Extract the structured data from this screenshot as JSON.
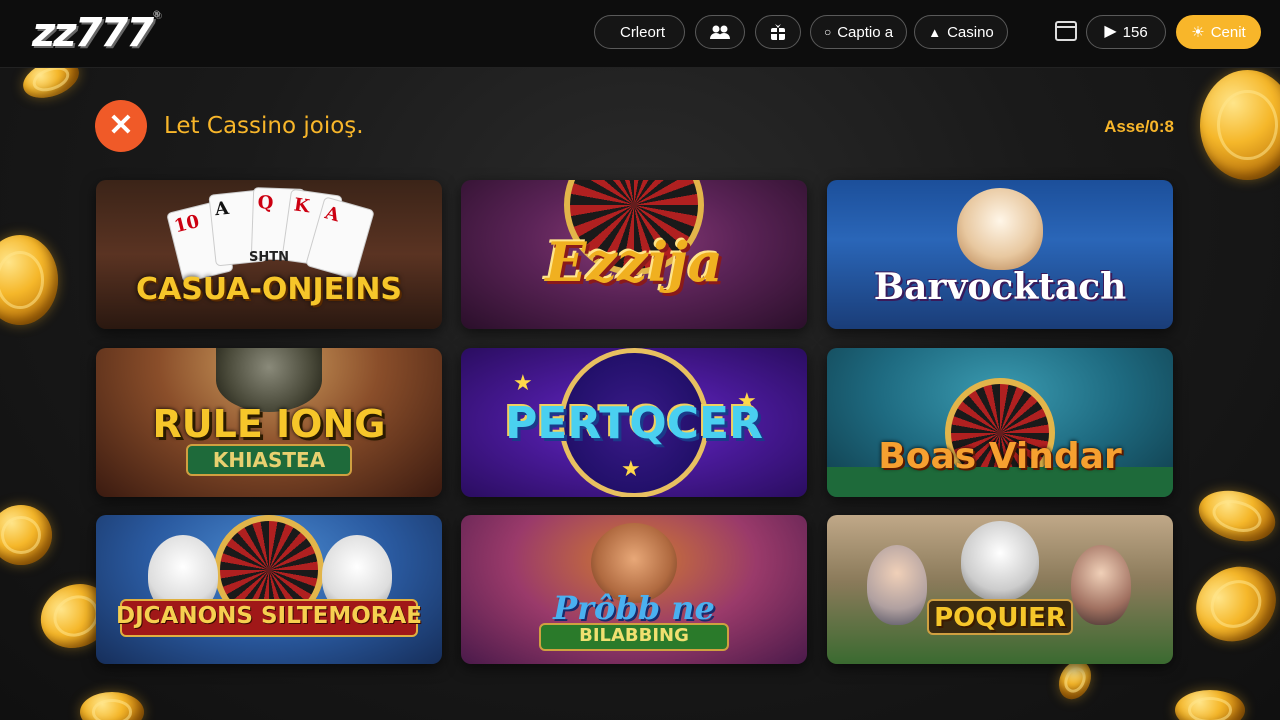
{
  "brand": {
    "logo_text": "zz777",
    "logo_mark": "®"
  },
  "nav": {
    "items": [
      {
        "label": "Crleort",
        "icon": "apple-icon"
      },
      {
        "label": "",
        "icon": "users-icon"
      },
      {
        "label": "",
        "icon": "gift-icon"
      },
      {
        "label": "Captio a",
        "icon": "user-icon"
      },
      {
        "label": "Casino",
        "icon": "casino-icon"
      }
    ],
    "calendar_icon": "calendar-icon",
    "play_count": "156",
    "cta_label": "Cenit",
    "colors": {
      "cta": "#f8b62a",
      "pill_border": "#5a5a5a"
    }
  },
  "subheader": {
    "close_icon": "close-icon",
    "title": "Let Cassino joioş.",
    "asset_label": "Asse/0:8",
    "colors": {
      "accent": "#f8b62a",
      "close_bg": "#f05a28"
    }
  },
  "games": [
    {
      "title": "CASUA-ONJEINS",
      "subtitle": "SHTN",
      "theme": "cards"
    },
    {
      "title": "Ezzija",
      "subtitle": "",
      "theme": "roulette-purple"
    },
    {
      "title": "Barvocktach",
      "subtitle": "",
      "theme": "dog-blue"
    },
    {
      "title": "RULE IONG",
      "subtitle": "KHIASTEA",
      "theme": "warrior"
    },
    {
      "title": "PERTQCER",
      "subtitle": "",
      "theme": "stars-purple"
    },
    {
      "title": "Boas Vindar",
      "subtitle": "",
      "theme": "roulette-teal"
    },
    {
      "title": "DJCANONS SILTEMORAE",
      "subtitle": "",
      "theme": "wolves"
    },
    {
      "title": "Prôbb ne",
      "subtitle": "BILABBING",
      "theme": "pirate"
    },
    {
      "title": "POQUIER",
      "subtitle": "",
      "theme": "village"
    }
  ]
}
